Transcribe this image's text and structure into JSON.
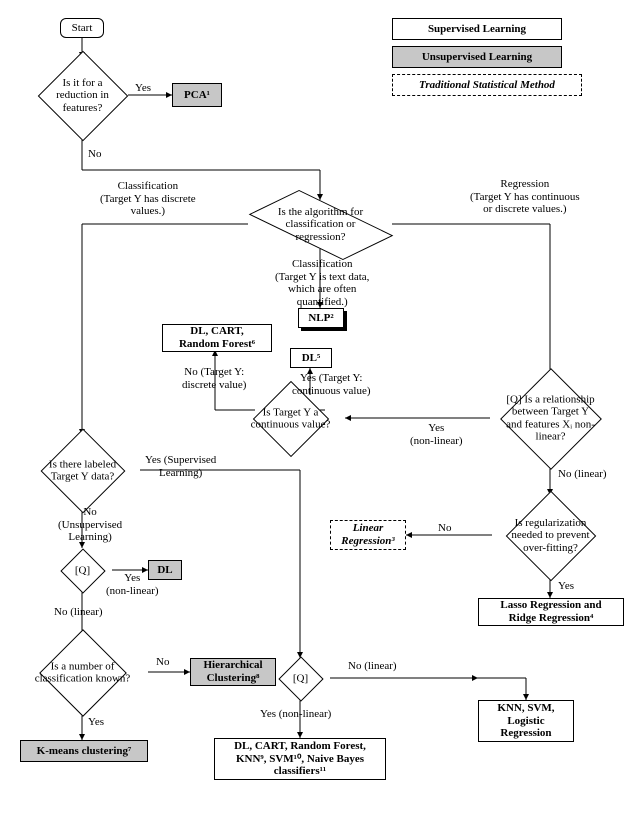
{
  "legend": {
    "supervised": "Supervised Learning",
    "unsupervised": "Unsupervised Learning",
    "traditional": "Traditional Statistical Method"
  },
  "nodes": {
    "start": "Start",
    "q_reduction": "Is it for a\nreduction in\nfeatures?",
    "pca": "PCA¹",
    "q_class_reg": "Is the algorithm for\nclassification or\nregression?",
    "nlp": "NLP²",
    "dl5": "DL⁵",
    "dlcartrf": "DL, CART,\nRandom Forest⁶",
    "q_cont": "Is Target Y a\ncontinuous value?",
    "q_nonlinear_reg": "[Q] Is a relationship\nbetween Target Y\nand features Xᵢ non-\nlinear?",
    "q_labeled": "Is there labeled\nTarget Y data?",
    "linreg": "Linear\nRegression³",
    "q_regularize": "Is regularization\nneeded to prevent\nover-fitting?",
    "lasso": "Lasso Regression and\nRidge Regression⁴",
    "q_q1": "[Q]",
    "dl": "DL",
    "q_numclass": "Is a number of\nclassification known?",
    "hier": "Hierarchical\nClustering⁸",
    "q_q2": "[Q]",
    "kmeans": "K-means clustering⁷",
    "dlcartrfk": "DL, CART, Random Forest,\nKNN⁹, SVM¹⁰, Naive Bayes\nclassifiers¹¹",
    "knnsvmlog": "KNN, SVM,\nLogistic\nRegression"
  },
  "labels": {
    "yes1": "Yes",
    "no1": "No",
    "class": "Classification\n(Target Y has discrete\nvalues.)",
    "regr": "Regression\n(Target Y has continuous\nor discrete values.)",
    "class_text": "Classification\n(Target Y is text data,\nwhich are often\nquantified.)",
    "no_dv": "No (Target Y:\ndiscrete value)",
    "yes_cv": "Yes (Target Y:\ncontinuous value)",
    "yes_nonlin": "Yes\n(non-linear)",
    "no_lin": "No (linear)",
    "yes_sup": "Yes (Supervised\nLearning)",
    "no_unsup": "No\n(Unsupervised\nLearning)",
    "yes_nl2": "Yes\n(non-linear)",
    "no_lin2": "No (linear)",
    "no2": "No",
    "yes2": "Yes",
    "no3": "No",
    "yes3": "Yes",
    "no_lin3": "No (linear)",
    "yes_nl3": "Yes (non-linear)"
  }
}
